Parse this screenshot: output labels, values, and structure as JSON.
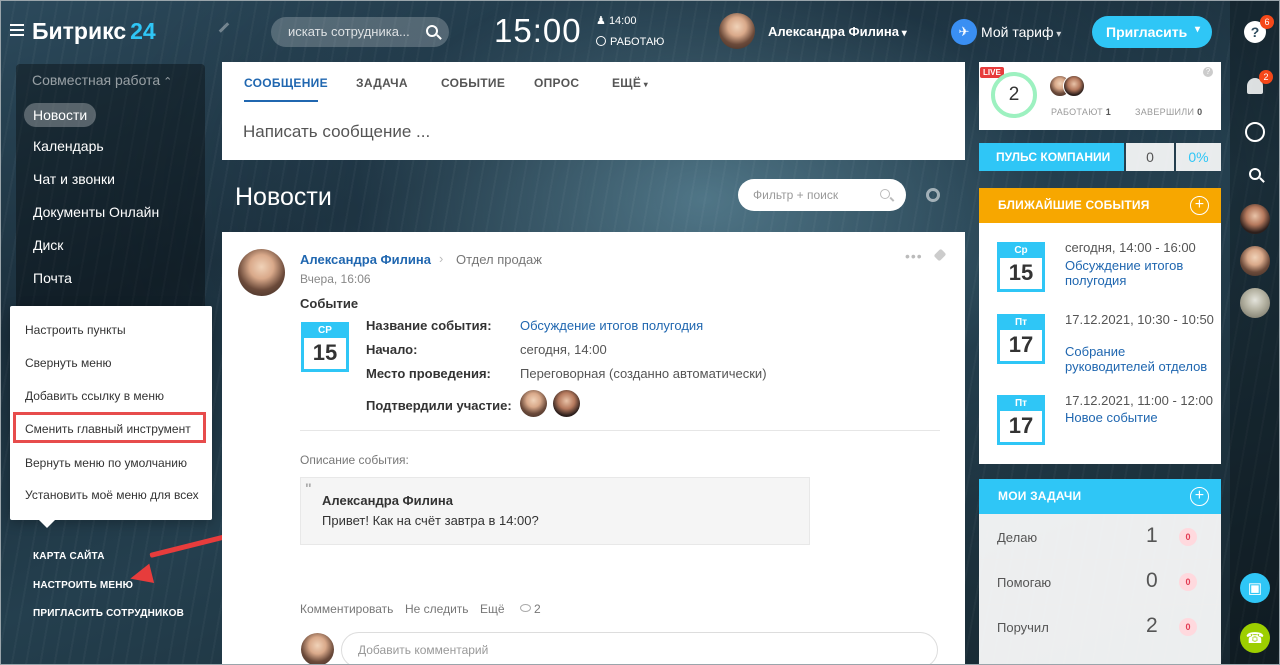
{
  "header": {
    "logo_text": "Битрикс",
    "logo_num": "24",
    "search_placeholder": "искать сотрудника...",
    "clock": "15:00",
    "workday_time": "14:00",
    "workday_status": "РАБОТАЮ",
    "user_name": "Александра Филина",
    "tariff_icon": "✈",
    "tariff_label": "Мой тариф",
    "invite_label": "Пригласить"
  },
  "rail": {
    "help_icon": "?",
    "help_badge": "6",
    "notifications_badge": "2",
    "phone_icon": "☎",
    "screen_icon": "▣"
  },
  "left_menu": {
    "section": "Совместная работа",
    "items": [
      "Новости",
      "Календарь",
      "Чат и звонки",
      "Документы Онлайн",
      "Диск",
      "Почта"
    ],
    "popup": [
      "Настроить пункты",
      "Свернуть меню",
      "Добавить ссылку в меню",
      "Сменить главный инструмент",
      "Вернуть меню по умолчанию",
      "Установить моё меню для всех"
    ],
    "bottom_links": [
      "КАРТА САЙТА",
      "НАСТРОИТЬ МЕНЮ",
      "ПРИГЛАСИТЬ СОТРУДНИКОВ"
    ]
  },
  "composer": {
    "tabs": [
      "СООБЩЕНИЕ",
      "ЗАДАЧА",
      "СОБЫТИЕ",
      "ОПРОС",
      "ЕЩЁ"
    ],
    "placeholder": "Написать сообщение ..."
  },
  "feed": {
    "title": "Новости",
    "filter_placeholder": "Фильтр + поиск"
  },
  "post": {
    "author": "Александра Филина",
    "destination": "Отдел продаж",
    "time": "Вчера, 16:06",
    "type": "Событие",
    "cal_weekday": "СР",
    "cal_day": "15",
    "labels": {
      "name": "Название события:",
      "start": "Начало:",
      "place": "Место проведения:",
      "confirmed": "Подтвердили участие:"
    },
    "values": {
      "name": "Обсуждение итогов полугодия",
      "start": "сегодня, 14:00",
      "place": "Переговорная (созданно автоматически)"
    },
    "desc_label": "Описание события:",
    "quote_author": "Александра Филина",
    "quote_text": "Привет! Как на счёт завтра в 14:00?",
    "actions": [
      "Комментировать",
      "Не следить",
      "Ещё"
    ],
    "views": "2",
    "comment_placeholder": "Добавить комментарий"
  },
  "pulse": {
    "live": "LIVE",
    "count": "2",
    "working_label": "РАБОТАЮТ",
    "working_count": "1",
    "finished_label": "ЗАВЕРШИЛИ",
    "finished_count": "0",
    "help": "?"
  },
  "company_pulse": {
    "title": "ПУЛЬС КОМПАНИИ",
    "value": "0",
    "percent": "0%"
  },
  "events": {
    "title": "БЛИЖАЙШИЕ СОБЫТИЯ",
    "accent": "#f7a700",
    "items": [
      {
        "weekday": "Ср",
        "day": "15",
        "date": "сегодня, 14:00 - 16:00",
        "title": "Обсуждение итогов полугодия"
      },
      {
        "weekday": "Пт",
        "day": "17",
        "date": "17.12.2021, 10:30 - 10:50",
        "title": "Собрание руководителей отделов"
      },
      {
        "weekday": "Пт",
        "day": "17",
        "date": "17.12.2021, 11:00 - 12:00",
        "title": "Новое событие"
      }
    ]
  },
  "tasks": {
    "title": "МОИ ЗАДАЧИ",
    "accent": "#2fc6f6",
    "items": [
      {
        "label": "Делаю",
        "count": "1",
        "badge": "0"
      },
      {
        "label": "Помогаю",
        "count": "0",
        "badge": "0"
      },
      {
        "label": "Поручил",
        "count": "2",
        "badge": "0"
      }
    ]
  }
}
